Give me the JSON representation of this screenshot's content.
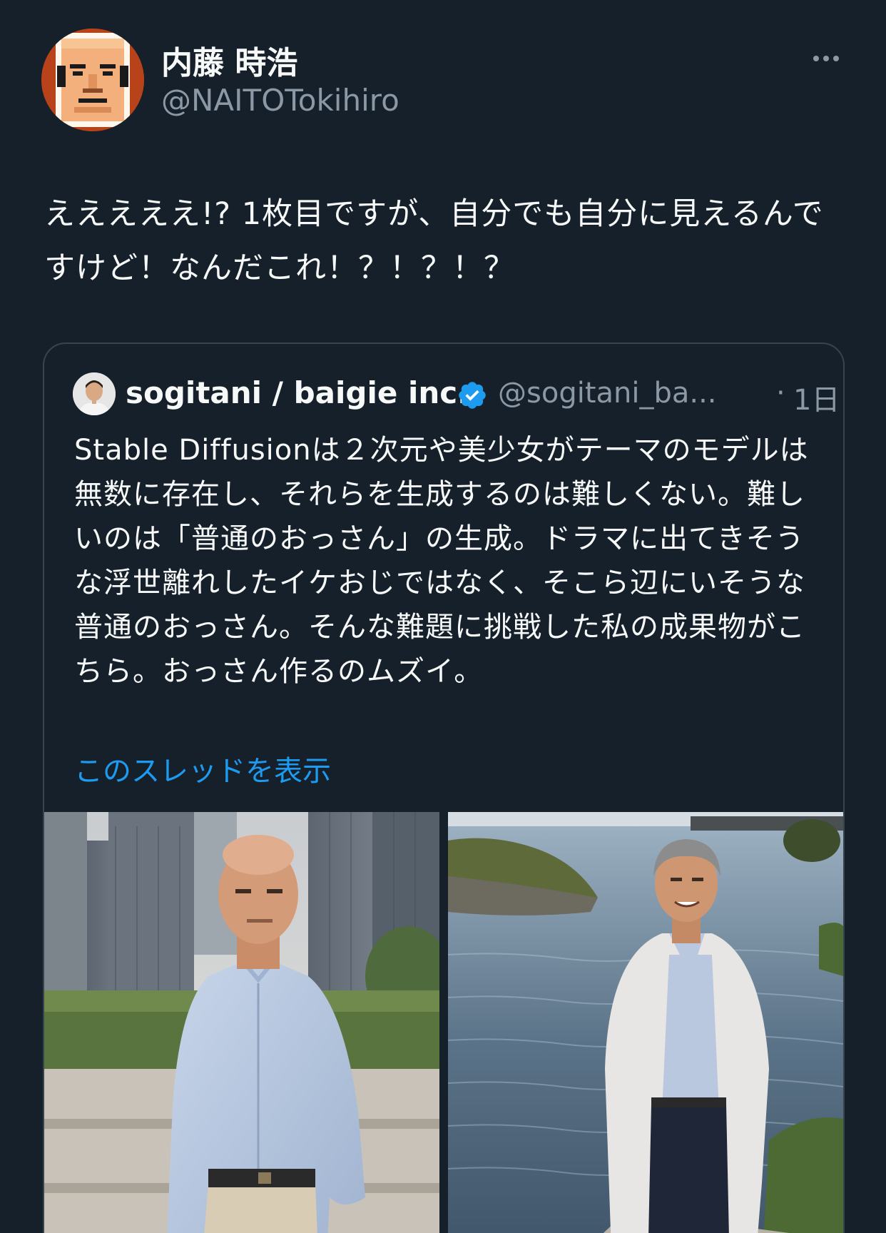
{
  "author": {
    "display_name": "内藤 時浩",
    "handle": "@NAITOTokihiro",
    "avatar_icon": "pixel-art-face-avatar"
  },
  "tweet": {
    "text": "えええええ!? 1枚目ですが、自分でも自分に見えるんですけど！なんだこれ！？！？！？"
  },
  "menu": {
    "more_icon": "more-horizontal-icon"
  },
  "quote": {
    "display_name": "sogitani / baigie inc.",
    "verified_icon": "verified-badge-icon",
    "verified_color": "#1d9bf0",
    "handle": "@sogitani_ba...",
    "separator": "·",
    "time": "1日",
    "text": "Stable Diffusionは２次元や美少女がテーマのモデルは無数に存在し、それらを生成するのは難しくない。難しいのは「普通のおっさん」の生成。ドラマに出てきそうな浮世離れしたイケおじではなく、そこら辺にいそうな普通のおっさん。そんな難題に挑戦した私の成果物がこちら。おっさん作るのムズイ。",
    "show_thread": "このスレッドを表示",
    "link_color": "#1d9bf0"
  },
  "media": [
    {
      "description_icon": "photo-man-city-buildings"
    },
    {
      "description_icon": "photo-man-waterfront"
    }
  ],
  "colors": {
    "background": "#15202b",
    "border": "#38444d",
    "secondary_text": "#8b98a5",
    "primary_text": "#f7f9f9"
  }
}
